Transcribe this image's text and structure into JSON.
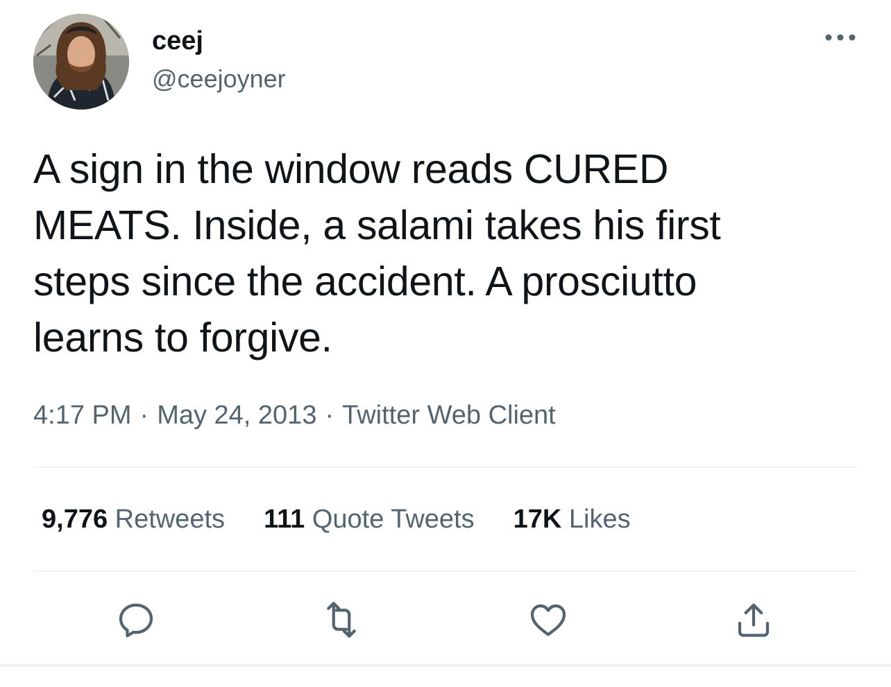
{
  "author": {
    "display_name": "ceej",
    "handle": "@ceejoyner"
  },
  "tweet": {
    "text": "A sign in the window reads CURED\nMEATS. Inside, a salami takes his first\nsteps since the accident. A prosciutto\nlearns to forgive.",
    "time": "4:17 PM",
    "date": "May 24, 2013",
    "source": "Twitter Web Client",
    "separator": "·"
  },
  "stats": {
    "retweets_count": "9,776",
    "retweets_label": "Retweets",
    "quotes_count": "111",
    "quotes_label": "Quote Tweets",
    "likes_count": "17K",
    "likes_label": "Likes"
  },
  "icons": {
    "more": "more-horizontal-icon",
    "reply": "reply-icon",
    "retweet": "retweet-icon",
    "like": "heart-icon",
    "share": "share-icon"
  },
  "colors": {
    "text_primary": "#0f1419",
    "text_secondary": "#536471",
    "divider": "#eff3f4"
  }
}
